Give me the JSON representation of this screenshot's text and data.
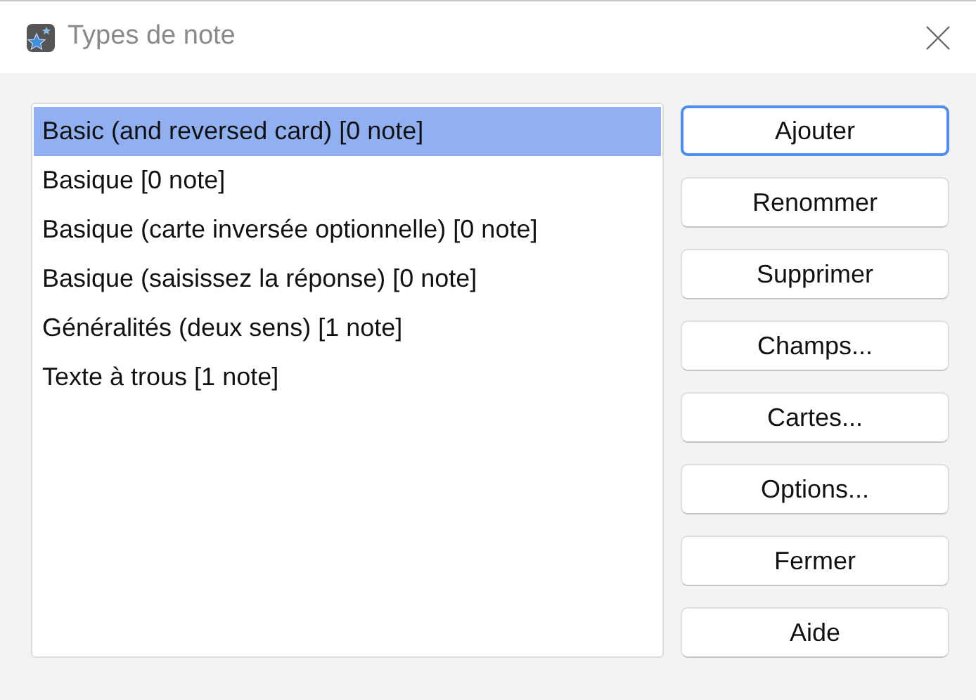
{
  "window": {
    "title": "Types de note"
  },
  "note_types": [
    {
      "label": "Basic (and reversed card) [0 note]",
      "selected": true
    },
    {
      "label": "Basique [0 note]",
      "selected": false
    },
    {
      "label": "Basique (carte inversée optionnelle) [0 note]",
      "selected": false
    },
    {
      "label": "Basique (saisissez la réponse) [0 note]",
      "selected": false
    },
    {
      "label": "Généralités (deux sens) [1 note]",
      "selected": false
    },
    {
      "label": "Texte à trous [1 note]",
      "selected": false
    }
  ],
  "buttons": [
    {
      "label": "Ajouter",
      "focused": true
    },
    {
      "label": "Renommer",
      "focused": false
    },
    {
      "label": "Supprimer",
      "focused": false
    },
    {
      "label": "Champs...",
      "focused": false
    },
    {
      "label": "Cartes...",
      "focused": false
    },
    {
      "label": "Options...",
      "focused": false
    },
    {
      "label": "Fermer",
      "focused": false
    },
    {
      "label": "Aide",
      "focused": false
    }
  ]
}
